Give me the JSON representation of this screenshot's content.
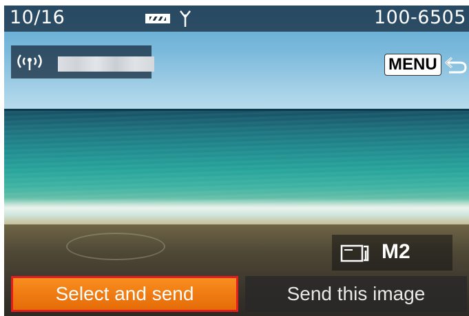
{
  "status_bar": {
    "counter": "10/16",
    "file_number": "100-6505",
    "battery_icon": "battery-icon",
    "antenna_icon": "antenna-icon"
  },
  "connection": {
    "wifi_icon": "wifi-icon",
    "device_name": ""
  },
  "menu": {
    "label": "MENU",
    "return_icon": "return-arrow-icon"
  },
  "mode": {
    "icon": "card-icon",
    "label": "M2"
  },
  "buttons": {
    "select_and_send": "Select and send",
    "send_this_image": "Send this image"
  },
  "colors": {
    "highlight_border": "#e41e1e",
    "selected_button": "#f07b12"
  }
}
